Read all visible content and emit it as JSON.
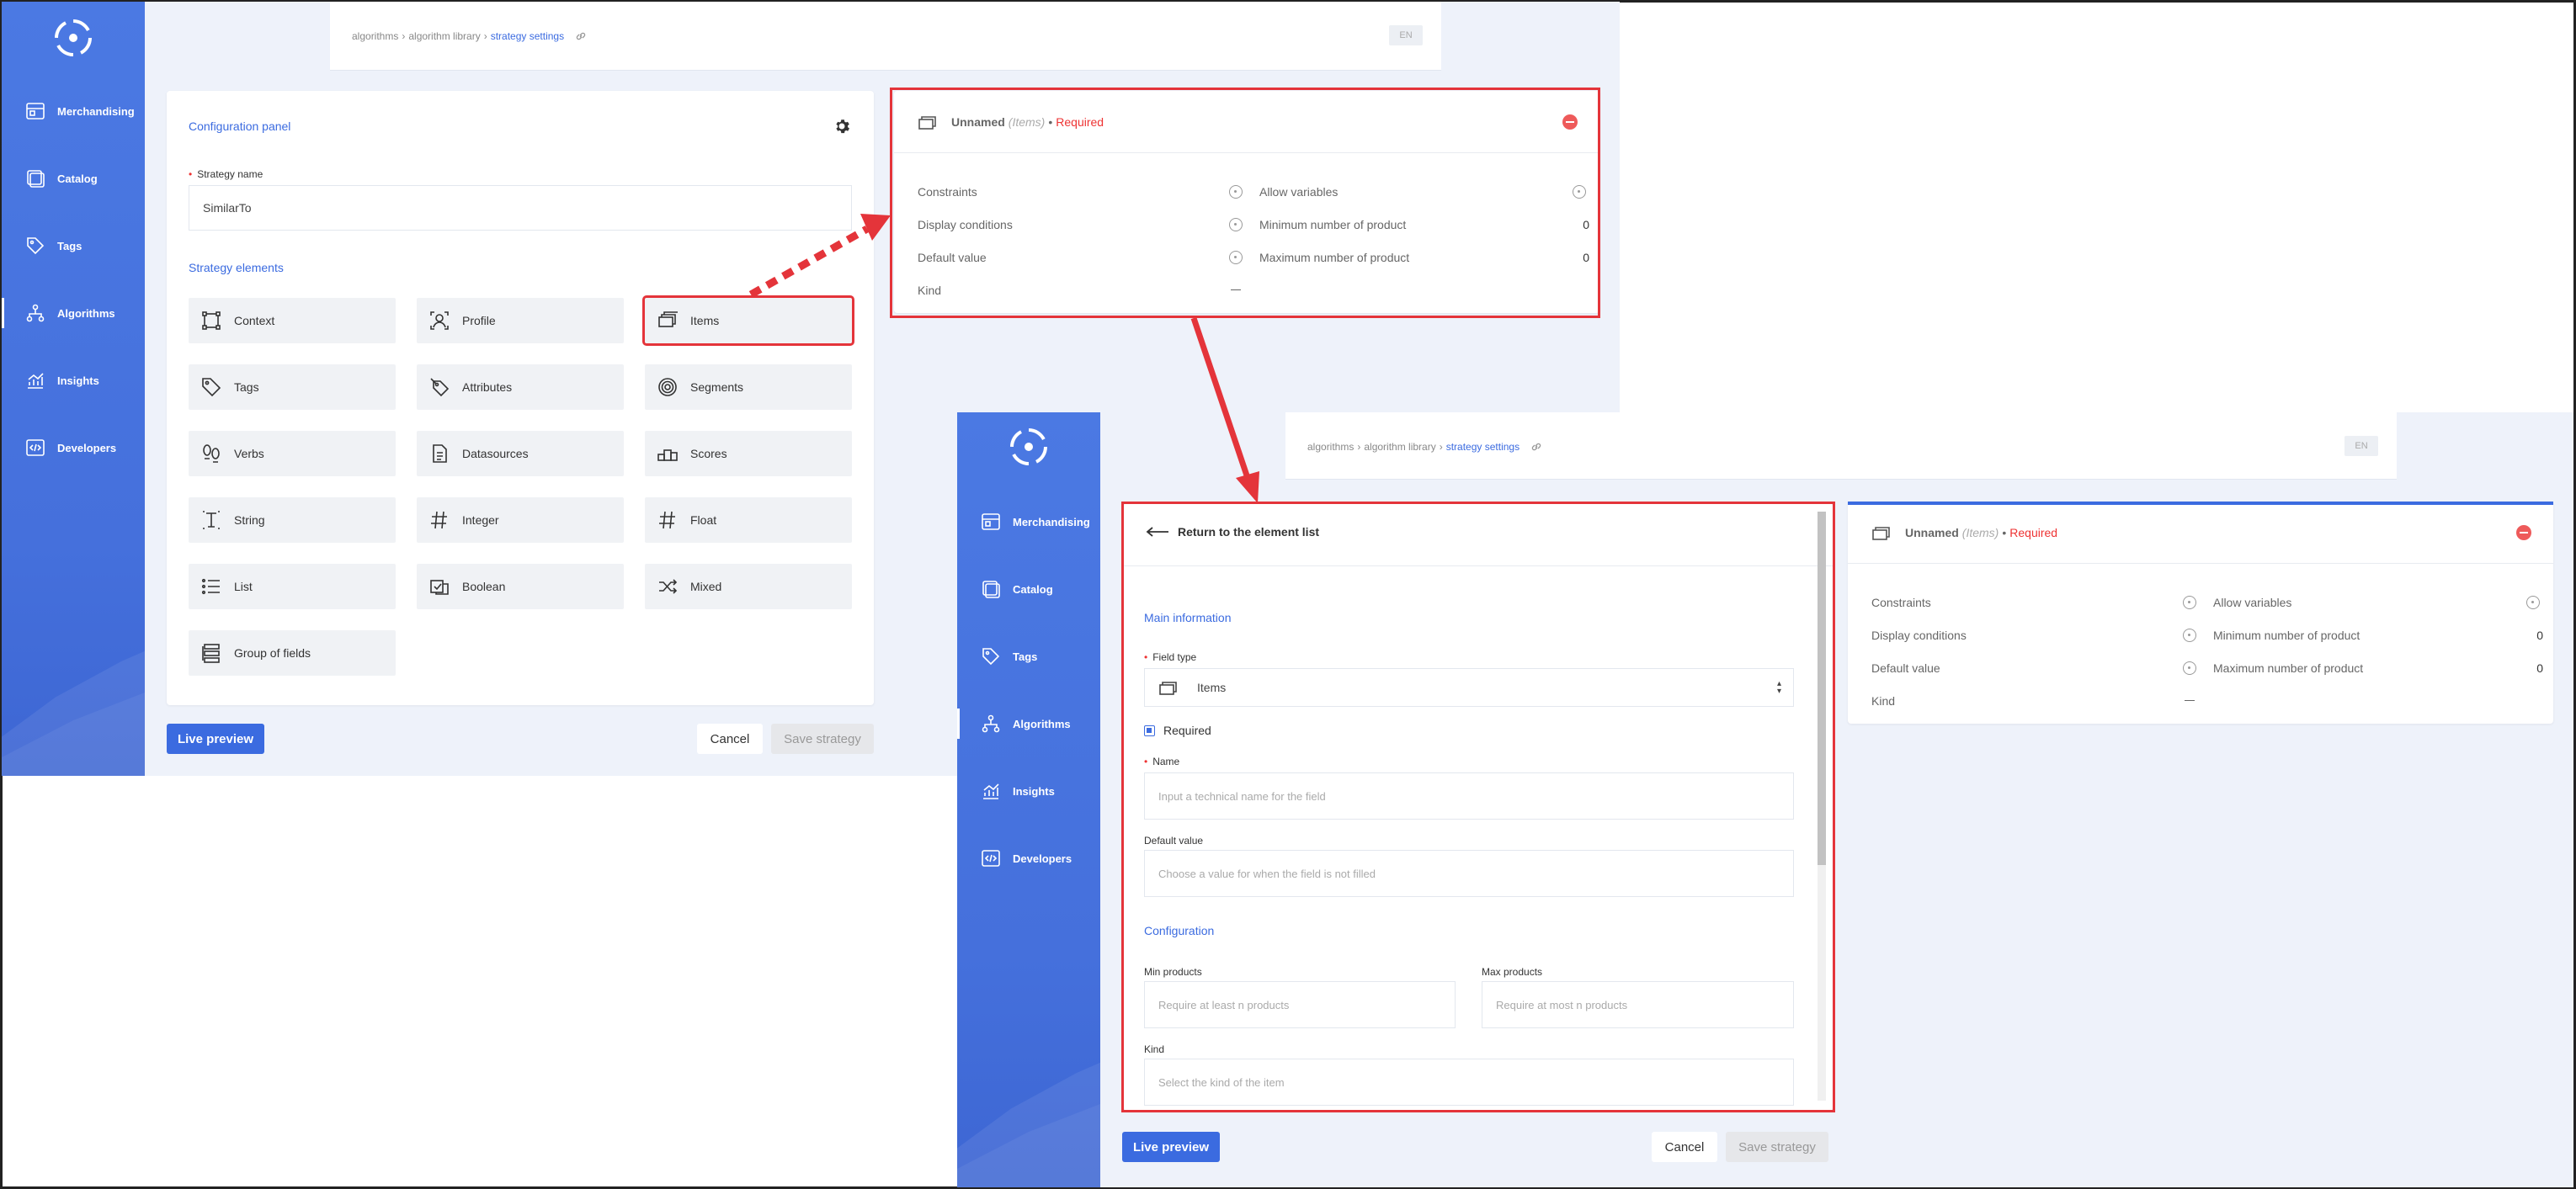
{
  "nav": [
    "Merchandising",
    "Catalog",
    "Tags",
    "Algorithms",
    "Insights",
    "Developers"
  ],
  "breadcrumb": {
    "a": "algorithms",
    "b": "algorithm library",
    "c": "strategy settings",
    "sep": "›"
  },
  "lang": "EN",
  "config": {
    "title": "Configuration panel",
    "strategy_name_label": "Strategy name",
    "strategy_name_value": "SimilarTo",
    "elements_title": "Strategy elements",
    "elements": [
      "Context",
      "Profile",
      "Items",
      "Tags",
      "Attributes",
      "Segments",
      "Verbs",
      "Datasources",
      "Scores",
      "String",
      "Integer",
      "Float",
      "List",
      "Boolean",
      "Mixed",
      "Group of fields"
    ]
  },
  "buttons": {
    "live_preview": "Live preview",
    "cancel": "Cancel",
    "save": "Save strategy"
  },
  "field_card": {
    "name": "Unnamed",
    "type": "(Items)",
    "dot": "•",
    "required": "Required",
    "props": [
      {
        "left": "Constraints",
        "right": "Allow variables",
        "rv": ""
      },
      {
        "left": "Display conditions",
        "right": "Minimum number of product",
        "rv": "0"
      },
      {
        "left": "Default value",
        "right": "Maximum number of product",
        "rv": "0"
      },
      {
        "left": "Kind",
        "right": "",
        "rv": ""
      }
    ]
  },
  "editor": {
    "back": "Return to the element list",
    "main_info": "Main information",
    "field_type_label": "Field type",
    "field_type_value": "Items",
    "required_label": "Required",
    "name_label": "Name",
    "name_ph": "Input a technical name for the field",
    "default_label": "Default value",
    "default_ph": "Choose a value for when the field is not filled",
    "configuration": "Configuration",
    "min_label": "Min products",
    "min_ph": "Require at least n products",
    "max_label": "Max products",
    "max_ph": "Require at most n products",
    "kind_label": "Kind",
    "kind_ph": "Select the kind of the item"
  },
  "colors": {
    "brand": "#4570dc",
    "accent": "#3b6be0",
    "annotation": "#e4343a",
    "required": "#e33"
  }
}
